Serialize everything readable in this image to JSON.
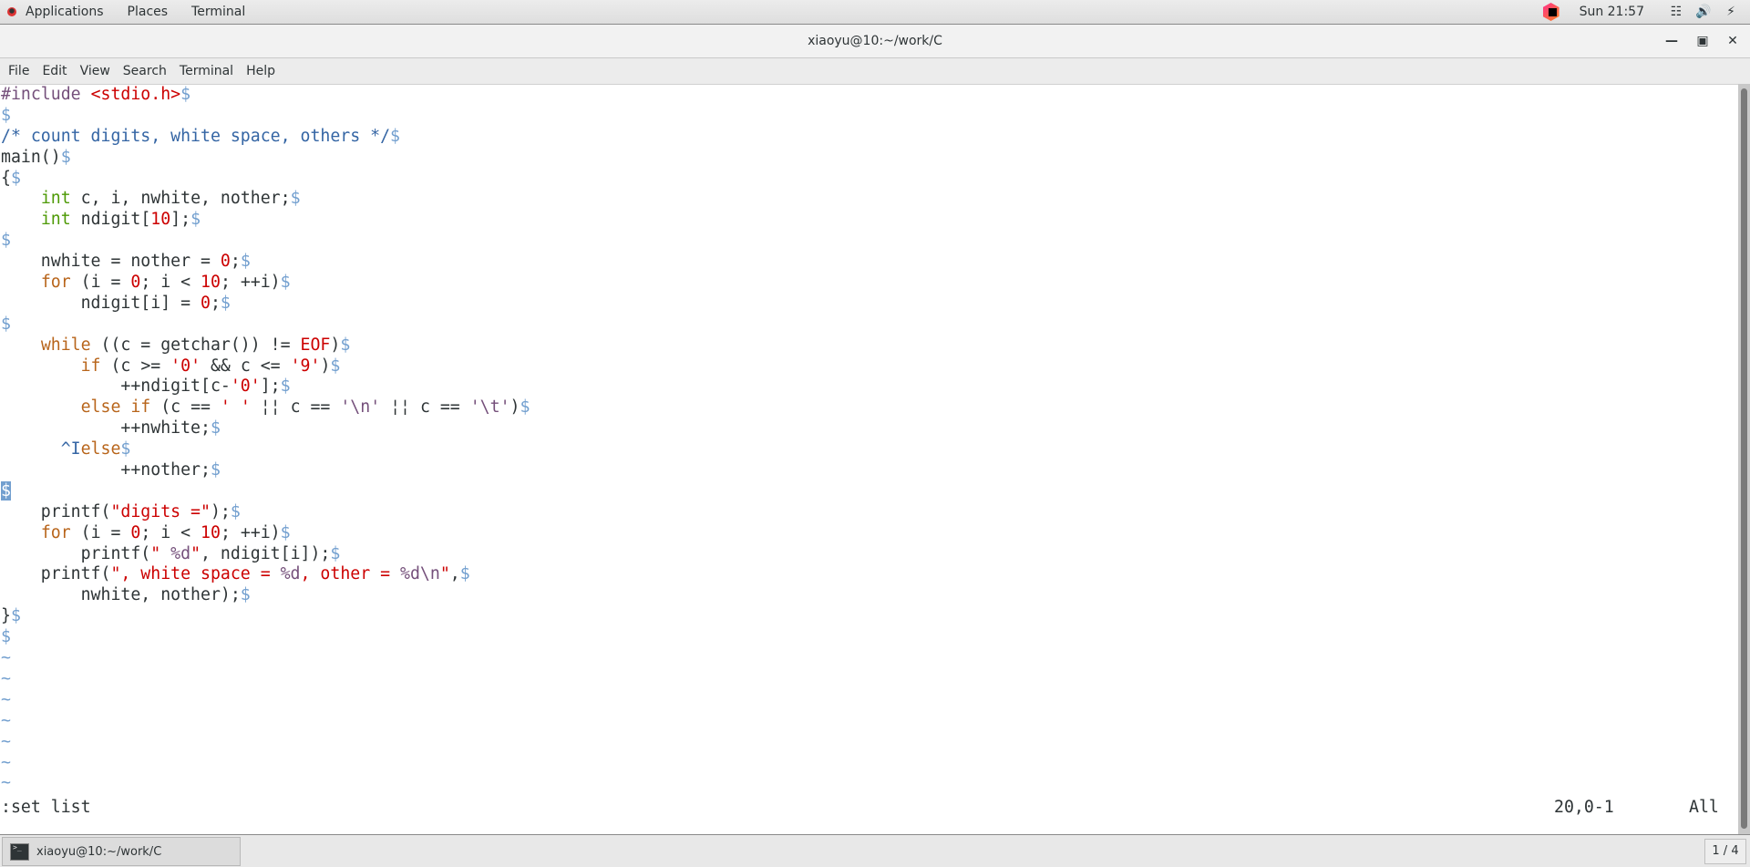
{
  "topbar": {
    "menus": [
      "Applications",
      "Places",
      "Terminal"
    ],
    "clock": "Sun 21:57",
    "tray_icons": [
      "network-icon",
      "volume-icon",
      "battery-icon"
    ]
  },
  "window": {
    "title": "xiaoyu@10:~/work/C",
    "buttons": [
      "minimize",
      "maximize",
      "close"
    ]
  },
  "menubar": [
    "File",
    "Edit",
    "View",
    "Search",
    "Terminal",
    "Help"
  ],
  "editor": {
    "mode": "vim :set list",
    "lines": [
      [
        [
          "pp",
          "#include "
        ],
        [
          "str",
          "<stdio.h>"
        ],
        [
          "eol",
          "$"
        ]
      ],
      [
        [
          "eol",
          "$"
        ]
      ],
      [
        [
          "cm",
          "/* count digits, white space, others */"
        ],
        [
          "eol",
          "$"
        ]
      ],
      [
        [
          "",
          "main()"
        ],
        [
          "eol",
          "$"
        ]
      ],
      [
        [
          "",
          "{"
        ],
        [
          "eol",
          "$"
        ]
      ],
      [
        [
          "",
          "    "
        ],
        [
          "ty",
          "int"
        ],
        [
          "",
          " c, i, nwhite, nother;"
        ],
        [
          "eol",
          "$"
        ]
      ],
      [
        [
          "",
          "    "
        ],
        [
          "ty",
          "int"
        ],
        [
          "",
          " ndigit["
        ],
        [
          "num",
          "10"
        ],
        [
          "",
          "];"
        ],
        [
          "eol",
          "$"
        ]
      ],
      [
        [
          "eol",
          "$"
        ]
      ],
      [
        [
          "",
          "    nwhite = nother = "
        ],
        [
          "num",
          "0"
        ],
        [
          "",
          ";"
        ],
        [
          "eol",
          "$"
        ]
      ],
      [
        [
          "",
          "    "
        ],
        [
          "kwo",
          "for"
        ],
        [
          "",
          " (i = "
        ],
        [
          "num",
          "0"
        ],
        [
          "",
          "; i < "
        ],
        [
          "num",
          "10"
        ],
        [
          "",
          "; ++i)"
        ],
        [
          "eol",
          "$"
        ]
      ],
      [
        [
          "",
          "        ndigit[i] = "
        ],
        [
          "num",
          "0"
        ],
        [
          "",
          ";"
        ],
        [
          "eol",
          "$"
        ]
      ],
      [
        [
          "eol",
          "$"
        ]
      ],
      [
        [
          "",
          "    "
        ],
        [
          "kwo",
          "while"
        ],
        [
          "",
          " ((c = getchar()) != "
        ],
        [
          "num",
          "EOF"
        ],
        [
          "",
          ")"
        ],
        [
          "eol",
          "$"
        ]
      ],
      [
        [
          "",
          "        "
        ],
        [
          "kwo",
          "if"
        ],
        [
          "",
          " (c >= "
        ],
        [
          "num",
          "'0'"
        ],
        [
          "",
          " && c <= "
        ],
        [
          "num",
          "'9'"
        ],
        [
          "",
          ")"
        ],
        [
          "eol",
          "$"
        ]
      ],
      [
        [
          "",
          "            ++ndigit[c-"
        ],
        [
          "num",
          "'0'"
        ],
        [
          "",
          "];"
        ],
        [
          "eol",
          "$"
        ]
      ],
      [
        [
          "",
          "        "
        ],
        [
          "kwo",
          "else if"
        ],
        [
          "",
          " (c == "
        ],
        [
          "num",
          "' '"
        ],
        [
          "",
          " ¦¦ c == "
        ],
        [
          "sp",
          "'\\n'"
        ],
        [
          "",
          " ¦¦ c == "
        ],
        [
          "sp",
          "'\\t'"
        ],
        [
          "",
          ")"
        ],
        [
          "eol",
          "$"
        ]
      ],
      [
        [
          "",
          "            ++nwhite;"
        ],
        [
          "eol",
          "$"
        ]
      ],
      [
        [
          "",
          "      "
        ],
        [
          "ctl",
          "^I"
        ],
        [
          "kwo",
          "else"
        ],
        [
          "eol",
          "$"
        ]
      ],
      [
        [
          "",
          "            ++nother;"
        ],
        [
          "eol",
          "$"
        ]
      ],
      [
        [
          "cur",
          "$"
        ]
      ],
      [
        [
          "",
          "    printf("
        ],
        [
          "str",
          "\"digits =\""
        ],
        [
          "",
          ");"
        ],
        [
          "eol",
          "$"
        ]
      ],
      [
        [
          "",
          "    "
        ],
        [
          "kwo",
          "for"
        ],
        [
          "",
          " (i = "
        ],
        [
          "num",
          "0"
        ],
        [
          "",
          "; i < "
        ],
        [
          "num",
          "10"
        ],
        [
          "",
          "; ++i)"
        ],
        [
          "eol",
          "$"
        ]
      ],
      [
        [
          "",
          "        printf("
        ],
        [
          "str",
          "\" "
        ],
        [
          "sp",
          "%d"
        ],
        [
          "str",
          "\""
        ],
        [
          "",
          ", ndigit[i]);"
        ],
        [
          "eol",
          "$"
        ]
      ],
      [
        [
          "",
          "    printf("
        ],
        [
          "str",
          "\", white space = "
        ],
        [
          "sp",
          "%d"
        ],
        [
          "str",
          ", other = "
        ],
        [
          "sp",
          "%d\\n"
        ],
        [
          "str",
          "\""
        ],
        [
          "",
          ","
        ],
        [
          "eol",
          "$"
        ]
      ],
      [
        [
          "",
          "        nwhite, nother);"
        ],
        [
          "eol",
          "$"
        ]
      ],
      [
        [
          "",
          "}"
        ],
        [
          "eol",
          "$"
        ]
      ],
      [
        [
          "eol",
          "$"
        ]
      ],
      [
        [
          "nt",
          "~"
        ]
      ],
      [
        [
          "nt",
          "~"
        ]
      ],
      [
        [
          "nt",
          "~"
        ]
      ],
      [
        [
          "nt",
          "~"
        ]
      ],
      [
        [
          "nt",
          "~"
        ]
      ],
      [
        [
          "nt",
          "~"
        ]
      ],
      [
        [
          "nt",
          "~"
        ]
      ]
    ],
    "command_line": ":set list",
    "ruler": "20,0-1",
    "scroll_position": "All"
  },
  "taskbar": {
    "task_label": "xiaoyu@10:~/work/C",
    "workspace": "1 / 4"
  }
}
